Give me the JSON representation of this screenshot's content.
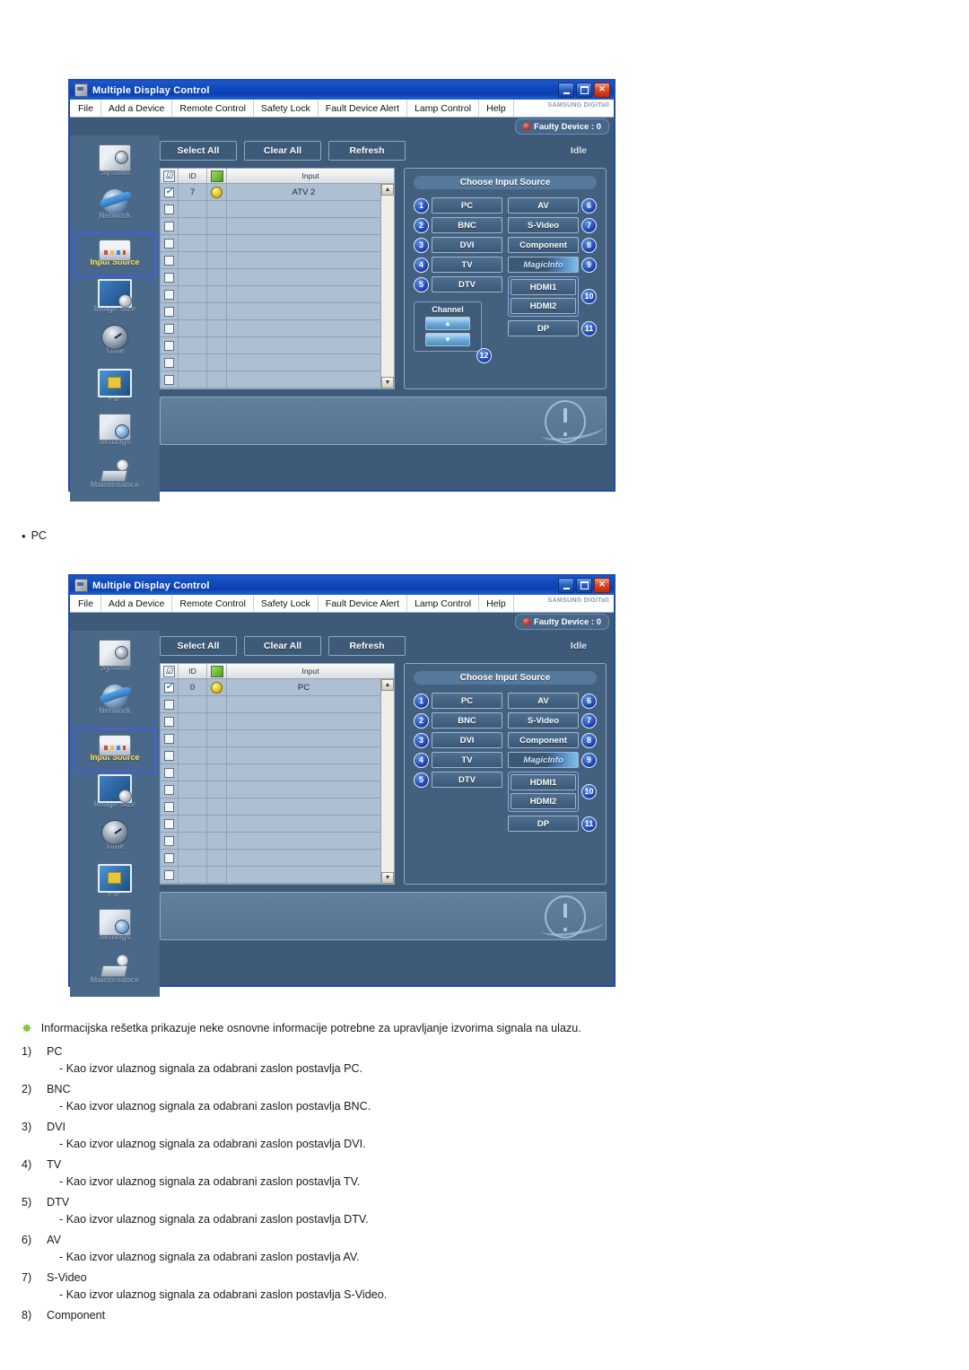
{
  "window": {
    "title": "Multiple Display Control",
    "titlebar_buttons": [
      {
        "name": "minimize",
        "glyph": "–"
      },
      {
        "name": "maximize",
        "glyph": "□"
      },
      {
        "name": "close",
        "glyph": "✕"
      }
    ],
    "menu": [
      "File",
      "Add a Device",
      "Remote Control",
      "Safety Lock",
      "Fault Device Alert",
      "Lamp Control",
      "Help"
    ],
    "brand_logo": "SAMSUNG DIGITall",
    "faulty_device": "Faulty Device : 0",
    "status": "Idle",
    "toolbar": [
      "Select All",
      "Clear All",
      "Refresh"
    ],
    "sidebar": [
      {
        "label": "System",
        "icon": "camera-system-icon",
        "active": false
      },
      {
        "label": "Network",
        "icon": "network-globe-icon",
        "active": false
      },
      {
        "label": "Input Source",
        "icon": "input-source-icon",
        "active": true
      },
      {
        "label": "Image Size",
        "icon": "image-size-icon",
        "active": false
      },
      {
        "label": "Time",
        "icon": "clock-icon",
        "active": false
      },
      {
        "label": "PIP",
        "icon": "pip-icon",
        "active": false
      },
      {
        "label": "Settings",
        "icon": "settings-cube-icon",
        "active": false
      },
      {
        "label": "Maintenance",
        "icon": "maintenance-icon",
        "active": false
      }
    ],
    "grid": {
      "columns": [
        "",
        "ID",
        "",
        "Input"
      ],
      "header_checkbox_glyph": "☑",
      "header_power_glyph": "AC",
      "empty_row_count": 11
    },
    "source_panel": {
      "title": "Choose Input Source",
      "left": [
        {
          "num": "1",
          "label": "PC"
        },
        {
          "num": "2",
          "label": "BNC"
        },
        {
          "num": "3",
          "label": "DVI"
        },
        {
          "num": "4",
          "label": "TV"
        },
        {
          "num": "5",
          "label": "DTV"
        }
      ],
      "right": [
        {
          "num": "6",
          "label": "AV"
        },
        {
          "num": "7",
          "label": "S-Video"
        },
        {
          "num": "8",
          "label": "Component"
        },
        {
          "num": "9",
          "label": "MagicInfo",
          "style": "magic"
        }
      ],
      "hdmi": {
        "num": "10",
        "items": [
          "HDMI1",
          "HDMI2"
        ]
      },
      "dp": {
        "num": "11",
        "label": "DP"
      },
      "channel": {
        "num": "12",
        "label": "Channel",
        "up_glyph": "▲",
        "down_glyph": "▼"
      }
    }
  },
  "screen_one": {
    "row": {
      "checked": true,
      "checkbox_glyph": "✓",
      "id": "7",
      "input": "ATV 2"
    },
    "has_channel": true
  },
  "screen_two": {
    "row": {
      "checked": true,
      "checkbox_glyph": "✓",
      "id": "0",
      "input": "PC"
    },
    "has_channel": false
  },
  "captions": {
    "pc_bullet": "PC",
    "bullet_glyph": "•"
  },
  "notes": {
    "star_glyph": "✸",
    "intro": "Informacijska rešetka prikazuje neke osnovne informacije potrebne za upravljanje izvorima signala na ulazu.",
    "items": [
      {
        "num": "1)",
        "term": "PC",
        "desc": "- Kao izvor ulaznog signala za odabrani zaslon postavlja PC."
      },
      {
        "num": "2)",
        "term": "BNC",
        "desc": "- Kao izvor ulaznog signala za odabrani zaslon postavlja BNC."
      },
      {
        "num": "3)",
        "term": "DVI",
        "desc": "- Kao izvor ulaznog signala za odabrani zaslon postavlja DVI."
      },
      {
        "num": "4)",
        "term": "TV",
        "desc": "- Kao izvor ulaznog signala za odabrani zaslon postavlja TV."
      },
      {
        "num": "5)",
        "term": "DTV",
        "desc": "- Kao izvor ulaznog signala za odabrani zaslon postavlja DTV."
      },
      {
        "num": "6)",
        "term": "AV",
        "desc": "- Kao izvor ulaznog signala za odabrani zaslon postavlja AV."
      },
      {
        "num": "7)",
        "term": "S-Video",
        "desc": "- Kao izvor ulaznog signala za odabrani zaslon postavlja S-Video."
      },
      {
        "num": "8)",
        "term": "Component",
        "desc": ""
      }
    ]
  },
  "colors": {
    "titlebar_blue": "#1049be",
    "window_bg": "#3d5a78",
    "sidebar_bg": "#4a6887",
    "accent_yellow": "#ffe14d",
    "badge_blue": "#173fa8",
    "status_red": "#cc1f08",
    "status_amber": "#e3c21a",
    "star_green": "#7ac943"
  }
}
